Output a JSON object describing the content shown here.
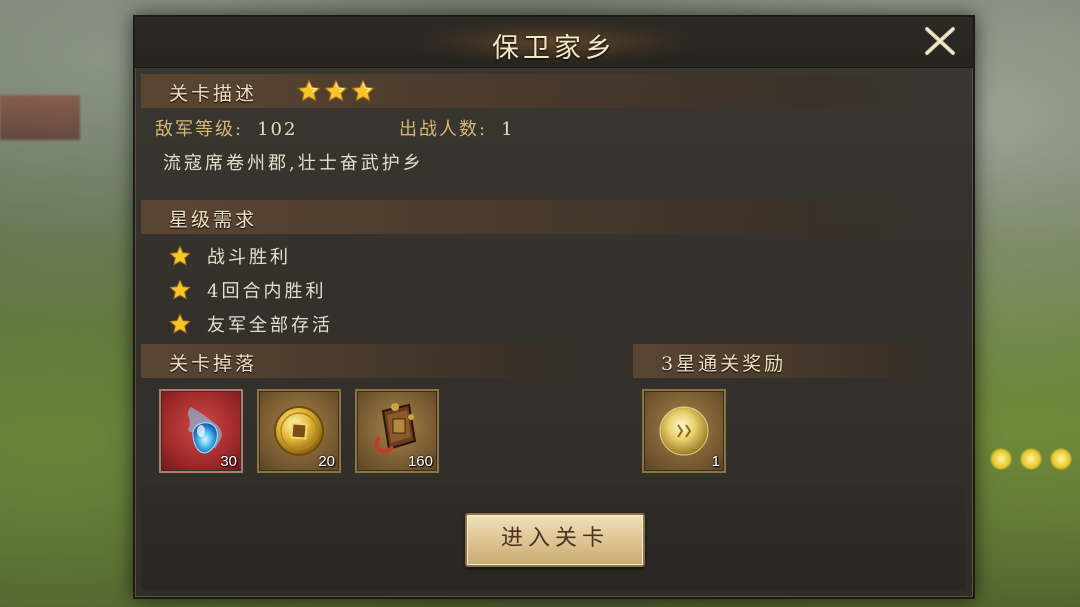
{
  "window": {
    "title": "保卫家乡",
    "close_icon": "close-x-icon"
  },
  "stage_desc": {
    "header": "关卡描述",
    "stars_earned": 3,
    "enemy_level_label": "敌军等级:",
    "enemy_level_value": "102",
    "troops_label": "出战人数:",
    "troops_value": "1",
    "description": "流寇席卷州郡,壮士奋武护乡"
  },
  "star_requirements": {
    "header": "星级需求",
    "items": [
      {
        "icon": "star-icon",
        "label": "战斗胜利"
      },
      {
        "icon": "star-icon",
        "label": "4回合内胜利"
      },
      {
        "icon": "star-icon",
        "label": "友军全部存活"
      }
    ]
  },
  "drops": {
    "header": "关卡掉落",
    "items": [
      {
        "icon": "blue-spirit-crystal-icon",
        "count": "30",
        "frame": "red"
      },
      {
        "icon": "gold-coin-icon",
        "count": "20",
        "frame": "gold"
      },
      {
        "icon": "armor-bundle-icon",
        "count": "160",
        "frame": "gold"
      }
    ]
  },
  "reward": {
    "header": "3星通关奖励",
    "items": [
      {
        "icon": "golden-orb-icon",
        "count": "1",
        "frame": "gold"
      }
    ]
  },
  "actions": {
    "enter_label": "进入关卡"
  },
  "colors": {
    "accent_gold": "#d7b678",
    "star_yellow": "#f7c52a",
    "panel_bg": "#34312c",
    "button_bg": "#dcc391"
  }
}
